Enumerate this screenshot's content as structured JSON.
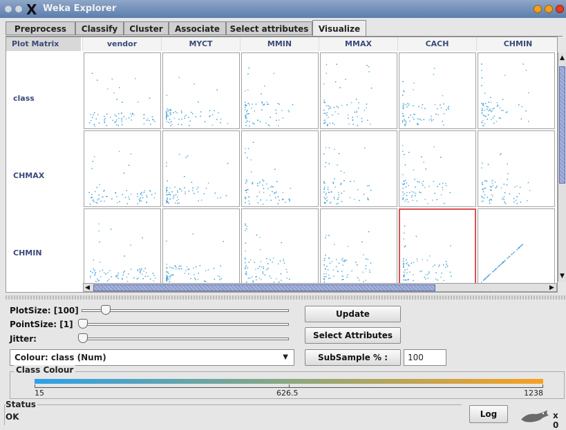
{
  "window": {
    "title": "Weka Explorer"
  },
  "tabs": [
    "Preprocess",
    "Classify",
    "Cluster",
    "Associate",
    "Select attributes",
    "Visualize"
  ],
  "active_tab": "Visualize",
  "matrix": {
    "corner_label": "Plot Matrix",
    "columns": [
      "vendor",
      "MYCT",
      "MMIN",
      "MMAX",
      "CACH",
      "CHMIN"
    ],
    "rows": [
      "class",
      "CHMAX",
      "CHMIN"
    ],
    "selected_cell": {
      "row": "CHMIN",
      "column": "CACH"
    }
  },
  "controls": {
    "plot_size_label": "PlotSize: [100]",
    "point_size_label": "PointSize: [1]",
    "jitter_label": "Jitter:",
    "plot_size_value": 100,
    "point_size_value": 1,
    "jitter_value": 0,
    "update_button": "Update",
    "select_attributes_button": "Select Attributes",
    "subsample_label": "SubSample % :",
    "subsample_value": "100",
    "colour_select": "Colour: class  (Num)"
  },
  "class_colour": {
    "title": "Class Colour",
    "min_label": "15",
    "mid_label": "626.5",
    "max_label": "1238",
    "low_color": "#2ea0e8",
    "high_color": "#f7a020"
  },
  "status": {
    "title": "Status",
    "text": "OK",
    "log_button": "Log",
    "count": "x 0"
  }
}
